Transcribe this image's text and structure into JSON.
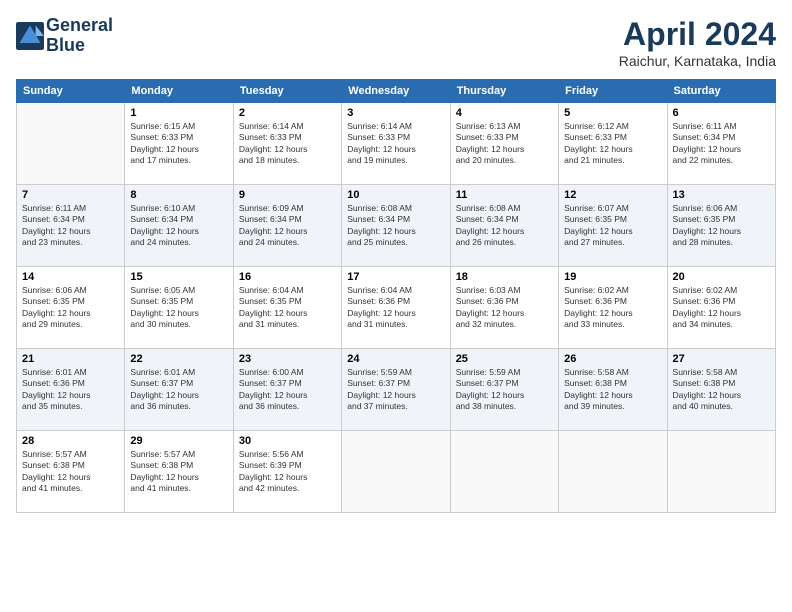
{
  "header": {
    "logo_line1": "General",
    "logo_line2": "Blue",
    "month": "April 2024",
    "location": "Raichur, Karnataka, India"
  },
  "weekdays": [
    "Sunday",
    "Monday",
    "Tuesday",
    "Wednesday",
    "Thursday",
    "Friday",
    "Saturday"
  ],
  "weeks": [
    [
      {
        "day": "",
        "info": ""
      },
      {
        "day": "1",
        "info": "Sunrise: 6:15 AM\nSunset: 6:33 PM\nDaylight: 12 hours\nand 17 minutes."
      },
      {
        "day": "2",
        "info": "Sunrise: 6:14 AM\nSunset: 6:33 PM\nDaylight: 12 hours\nand 18 minutes."
      },
      {
        "day": "3",
        "info": "Sunrise: 6:14 AM\nSunset: 6:33 PM\nDaylight: 12 hours\nand 19 minutes."
      },
      {
        "day": "4",
        "info": "Sunrise: 6:13 AM\nSunset: 6:33 PM\nDaylight: 12 hours\nand 20 minutes."
      },
      {
        "day": "5",
        "info": "Sunrise: 6:12 AM\nSunset: 6:33 PM\nDaylight: 12 hours\nand 21 minutes."
      },
      {
        "day": "6",
        "info": "Sunrise: 6:11 AM\nSunset: 6:34 PM\nDaylight: 12 hours\nand 22 minutes."
      }
    ],
    [
      {
        "day": "7",
        "info": "Sunrise: 6:11 AM\nSunset: 6:34 PM\nDaylight: 12 hours\nand 23 minutes."
      },
      {
        "day": "8",
        "info": "Sunrise: 6:10 AM\nSunset: 6:34 PM\nDaylight: 12 hours\nand 24 minutes."
      },
      {
        "day": "9",
        "info": "Sunrise: 6:09 AM\nSunset: 6:34 PM\nDaylight: 12 hours\nand 24 minutes."
      },
      {
        "day": "10",
        "info": "Sunrise: 6:08 AM\nSunset: 6:34 PM\nDaylight: 12 hours\nand 25 minutes."
      },
      {
        "day": "11",
        "info": "Sunrise: 6:08 AM\nSunset: 6:34 PM\nDaylight: 12 hours\nand 26 minutes."
      },
      {
        "day": "12",
        "info": "Sunrise: 6:07 AM\nSunset: 6:35 PM\nDaylight: 12 hours\nand 27 minutes."
      },
      {
        "day": "13",
        "info": "Sunrise: 6:06 AM\nSunset: 6:35 PM\nDaylight: 12 hours\nand 28 minutes."
      }
    ],
    [
      {
        "day": "14",
        "info": "Sunrise: 6:06 AM\nSunset: 6:35 PM\nDaylight: 12 hours\nand 29 minutes."
      },
      {
        "day": "15",
        "info": "Sunrise: 6:05 AM\nSunset: 6:35 PM\nDaylight: 12 hours\nand 30 minutes."
      },
      {
        "day": "16",
        "info": "Sunrise: 6:04 AM\nSunset: 6:35 PM\nDaylight: 12 hours\nand 31 minutes."
      },
      {
        "day": "17",
        "info": "Sunrise: 6:04 AM\nSunset: 6:36 PM\nDaylight: 12 hours\nand 31 minutes."
      },
      {
        "day": "18",
        "info": "Sunrise: 6:03 AM\nSunset: 6:36 PM\nDaylight: 12 hours\nand 32 minutes."
      },
      {
        "day": "19",
        "info": "Sunrise: 6:02 AM\nSunset: 6:36 PM\nDaylight: 12 hours\nand 33 minutes."
      },
      {
        "day": "20",
        "info": "Sunrise: 6:02 AM\nSunset: 6:36 PM\nDaylight: 12 hours\nand 34 minutes."
      }
    ],
    [
      {
        "day": "21",
        "info": "Sunrise: 6:01 AM\nSunset: 6:36 PM\nDaylight: 12 hours\nand 35 minutes."
      },
      {
        "day": "22",
        "info": "Sunrise: 6:01 AM\nSunset: 6:37 PM\nDaylight: 12 hours\nand 36 minutes."
      },
      {
        "day": "23",
        "info": "Sunrise: 6:00 AM\nSunset: 6:37 PM\nDaylight: 12 hours\nand 36 minutes."
      },
      {
        "day": "24",
        "info": "Sunrise: 5:59 AM\nSunset: 6:37 PM\nDaylight: 12 hours\nand 37 minutes."
      },
      {
        "day": "25",
        "info": "Sunrise: 5:59 AM\nSunset: 6:37 PM\nDaylight: 12 hours\nand 38 minutes."
      },
      {
        "day": "26",
        "info": "Sunrise: 5:58 AM\nSunset: 6:38 PM\nDaylight: 12 hours\nand 39 minutes."
      },
      {
        "day": "27",
        "info": "Sunrise: 5:58 AM\nSunset: 6:38 PM\nDaylight: 12 hours\nand 40 minutes."
      }
    ],
    [
      {
        "day": "28",
        "info": "Sunrise: 5:57 AM\nSunset: 6:38 PM\nDaylight: 12 hours\nand 41 minutes."
      },
      {
        "day": "29",
        "info": "Sunrise: 5:57 AM\nSunset: 6:38 PM\nDaylight: 12 hours\nand 41 minutes."
      },
      {
        "day": "30",
        "info": "Sunrise: 5:56 AM\nSunset: 6:39 PM\nDaylight: 12 hours\nand 42 minutes."
      },
      {
        "day": "",
        "info": ""
      },
      {
        "day": "",
        "info": ""
      },
      {
        "day": "",
        "info": ""
      },
      {
        "day": "",
        "info": ""
      }
    ]
  ]
}
